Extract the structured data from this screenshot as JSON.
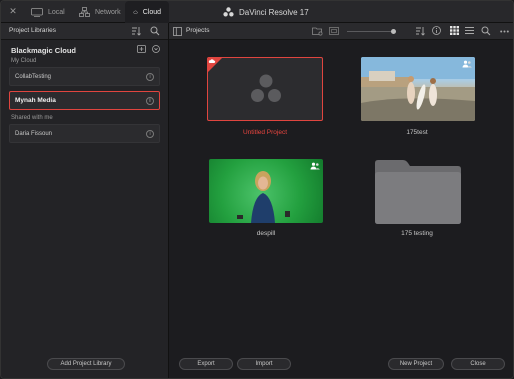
{
  "window": {
    "app_title": "DaVinci Resolve 17"
  },
  "tabs": [
    {
      "label": "Local"
    },
    {
      "label": "Network"
    },
    {
      "label": "Cloud"
    }
  ],
  "left": {
    "header": "Project Libraries",
    "section_title": "Blackmagic Cloud",
    "my_cloud_label": "My Cloud",
    "shared_label": "Shared with me",
    "items": [
      {
        "label": "CollabTesting"
      },
      {
        "label": "Mynah Media"
      },
      {
        "label": "Daria Fissoun"
      }
    ],
    "add_button": "Add Project Library"
  },
  "right": {
    "header": "Projects",
    "projects": [
      {
        "name": "Untitled Project"
      },
      {
        "name": "175test"
      },
      {
        "name": "despill"
      },
      {
        "name": "175 testing"
      }
    ]
  },
  "footer": {
    "export": "Export",
    "import": "Import",
    "new_project": "New Project",
    "close": "Close"
  },
  "colors": {
    "accent": "#e8453f",
    "background": "#1c1c1f",
    "panel": "#232326"
  }
}
